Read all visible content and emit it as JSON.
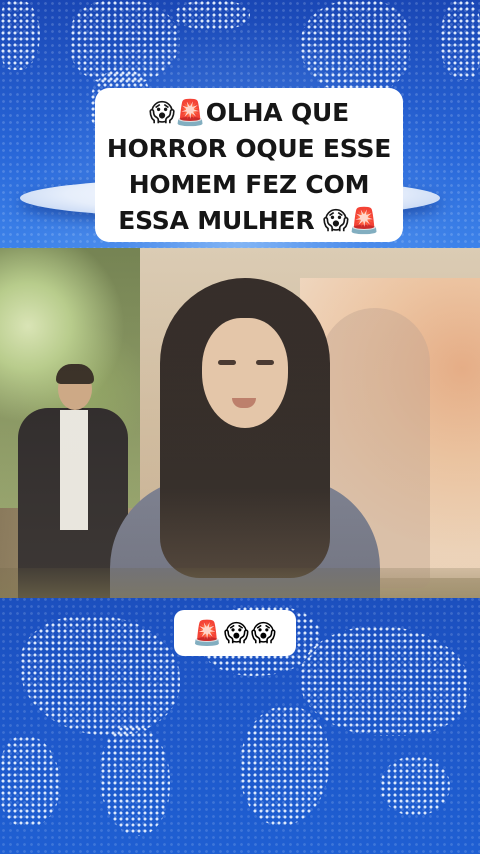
{
  "headline": {
    "text": "😱🚨OLHA QUE\nHORROR OQUE ESSE\nHOMEM FEZ COM\nESSA MULHER 😱🚨"
  },
  "emoji_caption": {
    "text": "🚨😱😱"
  },
  "colors": {
    "background_blue": "#1f57c6",
    "caption_box": "#ffffff",
    "caption_text": "#161616"
  }
}
